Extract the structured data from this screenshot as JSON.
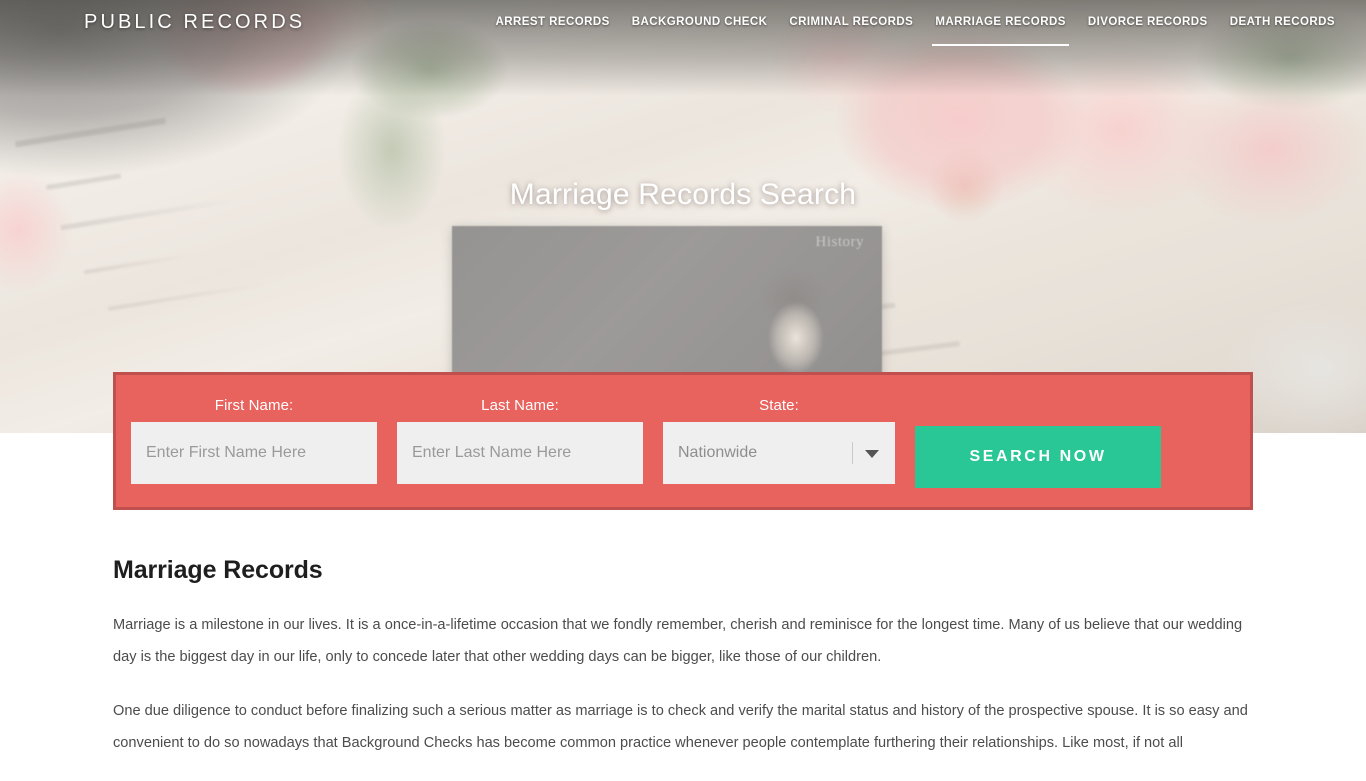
{
  "site": {
    "brand": "PUBLIC RECORDS",
    "accent_red": "#e8625e",
    "accent_red_border": "#c0504d",
    "accent_green": "#29c795",
    "hero_photo_caption": "History"
  },
  "nav": {
    "items": [
      {
        "label": "ARREST RECORDS",
        "active": false
      },
      {
        "label": "BACKGROUND CHECK",
        "active": false
      },
      {
        "label": "CRIMINAL RECORDS",
        "active": false
      },
      {
        "label": "MARRIAGE RECORDS",
        "active": true
      },
      {
        "label": "DIVORCE RECORDS",
        "active": false
      },
      {
        "label": "DEATH RECORDS",
        "active": false
      }
    ]
  },
  "hero": {
    "title": "Marriage Records Search"
  },
  "search_form": {
    "first_name": {
      "label": "First Name:",
      "placeholder": "Enter First Name Here",
      "value": ""
    },
    "last_name": {
      "label": "Last Name:",
      "placeholder": "Enter Last Name Here",
      "value": ""
    },
    "state": {
      "label": "State:",
      "selected": "Nationwide"
    },
    "submit_label": "SEARCH NOW"
  },
  "article": {
    "title": "Marriage Records",
    "paragraphs": [
      "Marriage is a milestone in our lives. It is a once-in-a-lifetime occasion that we fondly remember, cherish and reminisce for the longest time. Many of us believe that our wedding day is the biggest day in our life, only to concede later that other wedding days can be bigger, like those of our children.",
      "One due diligence to conduct before finalizing such a serious matter as marriage is to check and verify the marital status and history of the prospective spouse. It is so easy and convenient to do so nowadays that Background Checks has become common practice whenever people contemplate furthering their relationships. Like most, if not all"
    ]
  }
}
